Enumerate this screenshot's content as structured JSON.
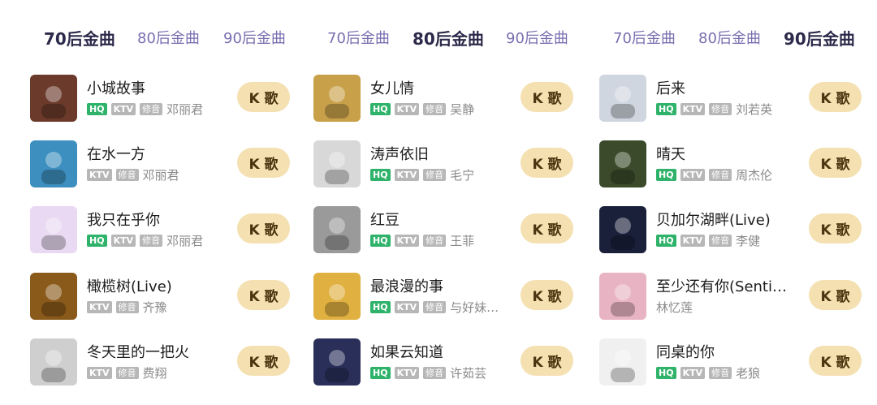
{
  "panels": [
    {
      "tabs": [
        "70后金曲",
        "80后金曲",
        "90后金曲"
      ],
      "active_tab": 0,
      "songs": [
        {
          "title": "小城故事",
          "hq": true,
          "ktv": true,
          "xiu": true,
          "artist": "邓丽君",
          "cover": "#6b3a2a"
        },
        {
          "title": "在水一方",
          "hq": false,
          "ktv": true,
          "xiu": true,
          "artist": "邓丽君",
          "cover": "#3d8fbf"
        },
        {
          "title": "我只在乎你",
          "hq": true,
          "ktv": true,
          "xiu": true,
          "artist": "邓丽君",
          "cover": "#e9d9f2"
        },
        {
          "title": "橄榄树(Live)",
          "hq": false,
          "ktv": true,
          "xiu": true,
          "artist": "齐豫",
          "cover": "#8a5a1a"
        },
        {
          "title": "冬天里的一把火",
          "hq": false,
          "ktv": true,
          "xiu": true,
          "artist": "费翔",
          "cover": "#cfcfcf"
        }
      ]
    },
    {
      "tabs": [
        "70后金曲",
        "80后金曲",
        "90后金曲"
      ],
      "active_tab": 1,
      "songs": [
        {
          "title": "女儿情",
          "hq": true,
          "ktv": true,
          "xiu": true,
          "artist": "吴静",
          "cover": "#c9a04a"
        },
        {
          "title": "涛声依旧",
          "hq": true,
          "ktv": true,
          "xiu": true,
          "artist": "毛宁",
          "cover": "#d8d8d8"
        },
        {
          "title": "红豆",
          "hq": true,
          "ktv": true,
          "xiu": true,
          "artist": "王菲",
          "cover": "#9a9a9a"
        },
        {
          "title": "最浪漫的事",
          "hq": true,
          "ktv": true,
          "xiu": true,
          "artist": "与好妹妹乐队",
          "cover": "#e0b040"
        },
        {
          "title": "如果云知道",
          "hq": true,
          "ktv": true,
          "xiu": true,
          "artist": "许茹芸",
          "cover": "#2a2f5a"
        }
      ]
    },
    {
      "tabs": [
        "70后金曲",
        "80后金曲",
        "90后金曲"
      ],
      "active_tab": 2,
      "songs": [
        {
          "title": "后来",
          "hq": true,
          "ktv": true,
          "xiu": true,
          "artist": "刘若英",
          "cover": "#cfd6df"
        },
        {
          "title": "晴天",
          "hq": true,
          "ktv": true,
          "xiu": true,
          "artist": "周杰伦",
          "cover": "#3a4a2a"
        },
        {
          "title": "贝加尔湖畔(Live)",
          "hq": true,
          "ktv": true,
          "xiu": true,
          "artist": "李健",
          "cover": "#1a1f3a"
        },
        {
          "title": "至少还有你(Sentimental)",
          "hq": false,
          "ktv": false,
          "xiu": false,
          "artist": "林忆莲",
          "cover": "#e8b4c4"
        },
        {
          "title": "同桌的你",
          "hq": true,
          "ktv": true,
          "xiu": true,
          "artist": "老狼",
          "cover": "#f0f0f0"
        }
      ]
    }
  ],
  "labels": {
    "hq": "HQ",
    "ktv": "KTV",
    "xiu": "修音",
    "kge": "K 歌"
  }
}
